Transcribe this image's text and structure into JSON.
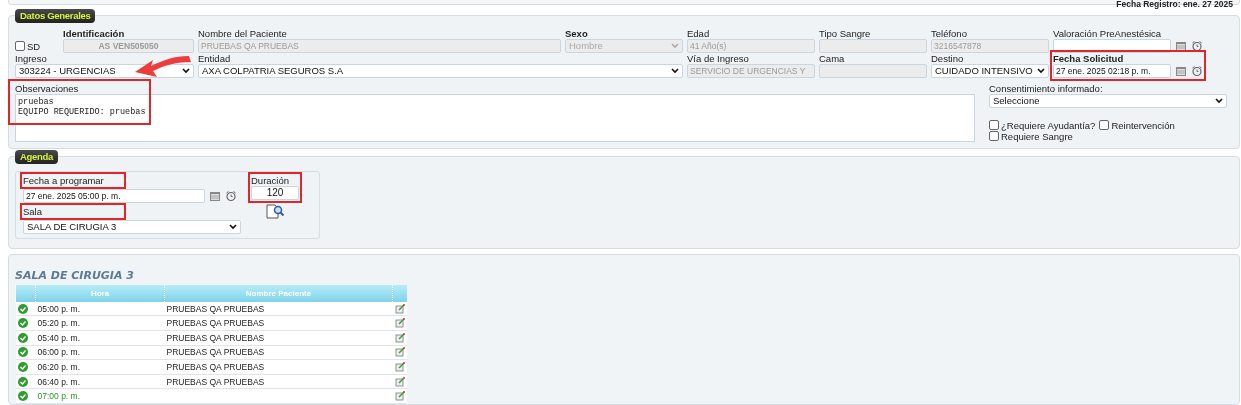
{
  "header": {
    "registro": "Fecha Registro: ene. 27 2025"
  },
  "datos_generales": {
    "legend": "Datos Generales",
    "sd": {
      "label": "SD",
      "checked": false
    },
    "row1": [
      {
        "label": "Identificación",
        "value": "AS VEN505050",
        "kind": "input",
        "disabled": true,
        "bold": true,
        "center": true
      },
      {
        "label": "Nombre del Paciente",
        "value": "PRUEBAS QA PRUEBAS",
        "kind": "input",
        "disabled": true,
        "bold": false
      },
      {
        "label": "Sexo",
        "value": "Hombre",
        "kind": "select",
        "disabled": true,
        "bold": true
      },
      {
        "label": "Edad",
        "value": "41 Año(s)",
        "kind": "input",
        "disabled": true,
        "bold": false
      },
      {
        "label": "Tipo Sangre",
        "kind": "input",
        "disabled": true,
        "bold": false
      },
      {
        "label": "Teléfono",
        "value": "3216547878",
        "kind": "input",
        "disabled": true,
        "bold": false
      },
      {
        "label": "Valoración PreAnestésica",
        "kind": "date",
        "disabled": false,
        "bold": false,
        "highlighted": false
      }
    ],
    "row2": [
      {
        "label": "Ingreso",
        "value": "303224 - URGENCIAS",
        "kind": "select",
        "disabled": false,
        "bold": false
      },
      {
        "label": "Entidad",
        "value": "AXA COLPATRIA SEGUROS S.A",
        "kind": "select",
        "disabled": false,
        "bold": false
      },
      {
        "label": "Vía de Ingreso",
        "value": "SERVICIO DE URGENCIAS Y",
        "kind": "input",
        "disabled": true,
        "bold": false
      },
      {
        "label": "Cama",
        "kind": "input",
        "disabled": true,
        "bold": false
      },
      {
        "label": "Destino",
        "value": "CUIDADO INTENSIVO",
        "kind": "select",
        "disabled": false,
        "bold": false
      },
      {
        "label": "Fecha Solicitud",
        "value": "27 ene. 2025 02:18 p. m.",
        "kind": "date",
        "disabled": false,
        "bold": true,
        "highlighted": true
      }
    ],
    "observaciones": {
      "label": "Observaciones",
      "lines": [
        "pruebas",
        "EQUIPO REQUERIDO: pruebas"
      ],
      "highlighted": true
    },
    "consentimiento": {
      "label": "Consentimiento informado:",
      "value": "Seleccione"
    },
    "checks": [
      {
        "label": "¿Requiere Ayudantía?",
        "checked": false
      },
      {
        "label": "Reintervención",
        "checked": false
      },
      {
        "label": "Requiere Sangre",
        "checked": false
      }
    ]
  },
  "agenda": {
    "legend": "Agenda",
    "fecha": {
      "label": "Fecha a programar",
      "value": "27 ene. 2025 05:00 p. m.",
      "highlighted": true
    },
    "duracion": {
      "label": "Duración",
      "value": "120",
      "highlighted": true
    },
    "sala": {
      "label": "Sala",
      "value": "SALA DE CIRUGIA 3",
      "highlighted": true
    }
  },
  "schedule": {
    "title": "SALA DE CIRUGIA 3",
    "columns": [
      "Hora",
      "Nombre Paciente"
    ],
    "rows": [
      {
        "hora": "05:00 p. m.",
        "paciente": "PRUEBAS QA PRUEBAS",
        "kind": "booked"
      },
      {
        "hora": "05:20 p. m.",
        "paciente": "PRUEBAS QA PRUEBAS",
        "kind": "booked"
      },
      {
        "hora": "05:40 p. m.",
        "paciente": "PRUEBAS QA PRUEBAS",
        "kind": "booked"
      },
      {
        "hora": "06:00 p. m.",
        "paciente": "PRUEBAS QA PRUEBAS",
        "kind": "booked"
      },
      {
        "hora": "06:20 p. m.",
        "paciente": "PRUEBAS QA PRUEBAS",
        "kind": "booked"
      },
      {
        "hora": "06:40 p. m.",
        "paciente": "PRUEBAS QA PRUEBAS",
        "kind": "booked"
      },
      {
        "hora": "07:00 p. m.",
        "kind": "free"
      }
    ]
  }
}
